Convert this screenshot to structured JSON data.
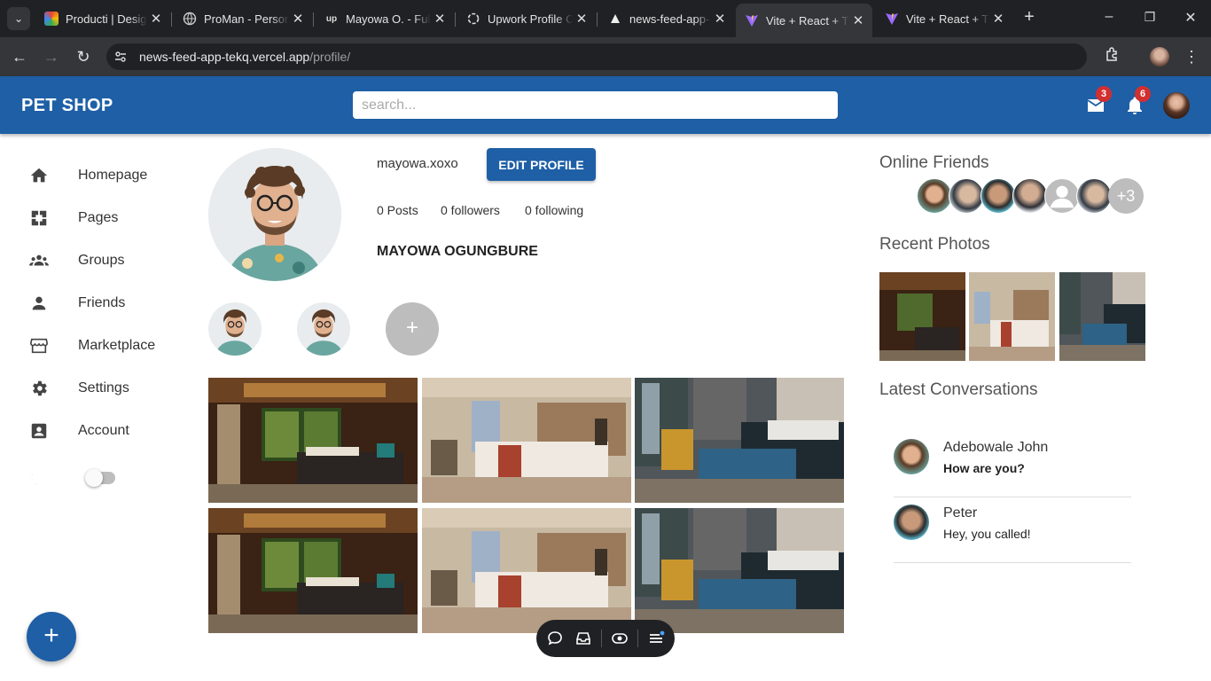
{
  "browser": {
    "tabs": [
      {
        "title": "Producti | Desig",
        "favicon": "colorful-logo-icon"
      },
      {
        "title": "ProMan - Person",
        "favicon": "globe-icon"
      },
      {
        "title": "Mayowa O. - Ful",
        "favicon": "upwork-icon"
      },
      {
        "title": "Upwork Profile C",
        "favicon": "openai-icon"
      },
      {
        "title": "news-feed-app-",
        "favicon": "vercel-icon"
      },
      {
        "title": "Vite + React + T",
        "favicon": "vite-icon",
        "active": true
      },
      {
        "title": "Vite + React + T",
        "favicon": "vite-icon"
      }
    ],
    "url_host": "news-feed-app-tekq.vercel.app",
    "url_path": "/profile/"
  },
  "header": {
    "brand": "PET SHOP",
    "search_placeholder": "search...",
    "mail_count": "3",
    "notification_count": "6"
  },
  "sidebar": {
    "items": [
      {
        "label": "Homepage",
        "icon": "home-icon"
      },
      {
        "label": "Pages",
        "icon": "pages-icon"
      },
      {
        "label": "Groups",
        "icon": "groups-icon"
      },
      {
        "label": "Friends",
        "icon": "person-icon"
      },
      {
        "label": "Marketplace",
        "icon": "store-icon"
      },
      {
        "label": "Settings",
        "icon": "gear-icon"
      },
      {
        "label": "Account",
        "icon": "account-box-icon"
      }
    ],
    "dark_mode_on": false,
    "fab_label": "+"
  },
  "profile": {
    "username": "mayowa.xoxo",
    "edit_label": "EDIT PROFILE",
    "posts": "0 Posts",
    "followers": "0 followers",
    "following": "0 following",
    "full_name": "MAYOWA OGUNGBURE",
    "add_story_label": "+"
  },
  "right": {
    "online_title": "Online Friends",
    "more_label": "+3",
    "photos_title": "Recent Photos",
    "conversations_title": "Latest Conversations",
    "conversations": [
      {
        "name": "Adebowale John",
        "message": "How are you?",
        "unread": true
      },
      {
        "name": "Peter",
        "message": "Hey, you called!",
        "unread": false
      }
    ]
  },
  "colors": {
    "primary": "#1e5fa6",
    "badge": "#d32f2f"
  }
}
